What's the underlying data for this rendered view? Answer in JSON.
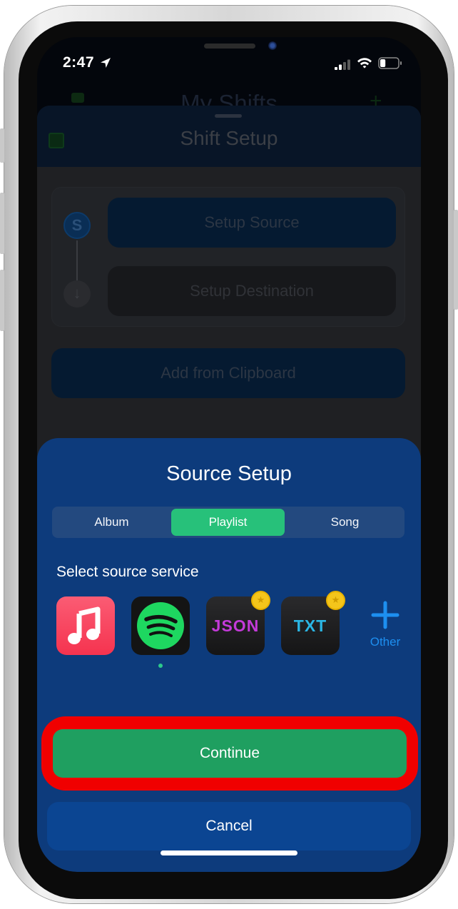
{
  "status_bar": {
    "time": "2:47",
    "location_icon": "location-arrow-icon",
    "signal_bars_active": 2,
    "signal_bars_total": 4,
    "wifi_icon": "wifi-icon",
    "battery_level": 0.3
  },
  "background_app": {
    "title": "My Shifts",
    "left_icon": "import-icon",
    "right_icon": "plus-icon",
    "sheet": {
      "title": "Shift Setup",
      "header_icon": "import-icon",
      "steps": [
        {
          "icon": "source-s-icon",
          "icon_glyph": "S",
          "label": "Setup Source"
        },
        {
          "icon": "arrow-down-icon",
          "icon_glyph": "↓",
          "label": "Setup Destination"
        }
      ],
      "clipboard_button": "Add from Clipboard"
    }
  },
  "source_setup": {
    "title": "Source Setup",
    "tabs": [
      {
        "label": "Album",
        "selected": false
      },
      {
        "label": "Playlist",
        "selected": true
      },
      {
        "label": "Song",
        "selected": false
      }
    ],
    "select_label": "Select source service",
    "services": [
      {
        "name": "Apple Music",
        "icon": "apple-music-icon",
        "selected": false,
        "premium": false
      },
      {
        "name": "Spotify",
        "icon": "spotify-icon",
        "selected": true,
        "premium": false
      },
      {
        "name": "JSON",
        "icon": "json-icon",
        "text": "JSON",
        "selected": false,
        "premium": true
      },
      {
        "name": "TXT",
        "icon": "txt-icon",
        "text": "TXT",
        "selected": false,
        "premium": true
      }
    ],
    "other_label": "Other",
    "continue_label": "Continue",
    "cancel_label": "Cancel"
  },
  "colors": {
    "sheet_bg": "#0d3b7c",
    "tab_selected": "#27c17a",
    "continue_bg": "#1f9f60",
    "cancel_bg": "#0b4592",
    "highlight_ring": "#f00000",
    "other_blue": "#1d8ff0",
    "premium_gold": "#f4c51b"
  }
}
